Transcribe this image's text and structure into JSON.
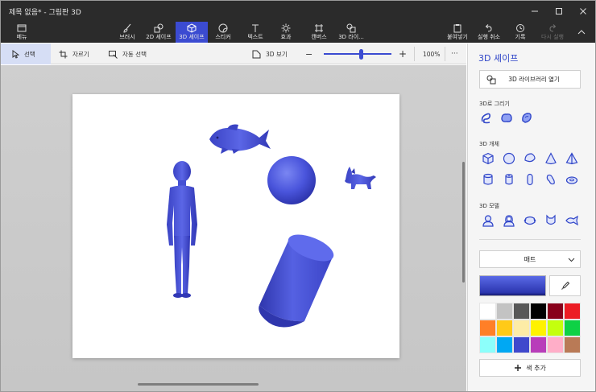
{
  "window": {
    "title": "제목 없음* - 그림판 3D"
  },
  "ribbon": {
    "menu": "메뉴",
    "tools": [
      {
        "label": "브러시"
      },
      {
        "label": "2D 셰이프"
      },
      {
        "label": "3D 셰이프"
      },
      {
        "label": "스티커"
      },
      {
        "label": "텍스트"
      },
      {
        "label": "효과"
      },
      {
        "label": "캔버스"
      },
      {
        "label": "3D 라이..."
      }
    ],
    "actions": [
      {
        "label": "붙여넣기"
      },
      {
        "label": "실행 취소"
      },
      {
        "label": "기록"
      },
      {
        "label": "다시 실행"
      }
    ]
  },
  "subtoolbar": {
    "select": "선택",
    "crop": "자르기",
    "magic_select": "자동 선택",
    "view3d": "3D 보기",
    "zoom_minus": "−",
    "zoom_plus": "+",
    "zoom_value": 55,
    "zoom_text": "100%",
    "more": "···"
  },
  "panel": {
    "title": "3D 셰이프",
    "library_button": "3D 라이브러리 열기",
    "draw_section": "3D로 그리기",
    "objects_section": "3D 개체",
    "models_section": "3D 모델",
    "material": "매트",
    "add_color": "색 추가",
    "current_color": "#3b45c8",
    "accent_color": "#2f45c8",
    "palette": [
      "#ffffff",
      "#c3c3c3",
      "#585858",
      "#000000",
      "#88001b",
      "#ec1c24",
      "#ff7f27",
      "#ffca18",
      "#fdeca6",
      "#fff200",
      "#c4ff0e",
      "#0ed145",
      "#8cfffb",
      "#00a8f3",
      "#3f48cc",
      "#b83dba",
      "#ffaec8",
      "#b97a56"
    ]
  }
}
